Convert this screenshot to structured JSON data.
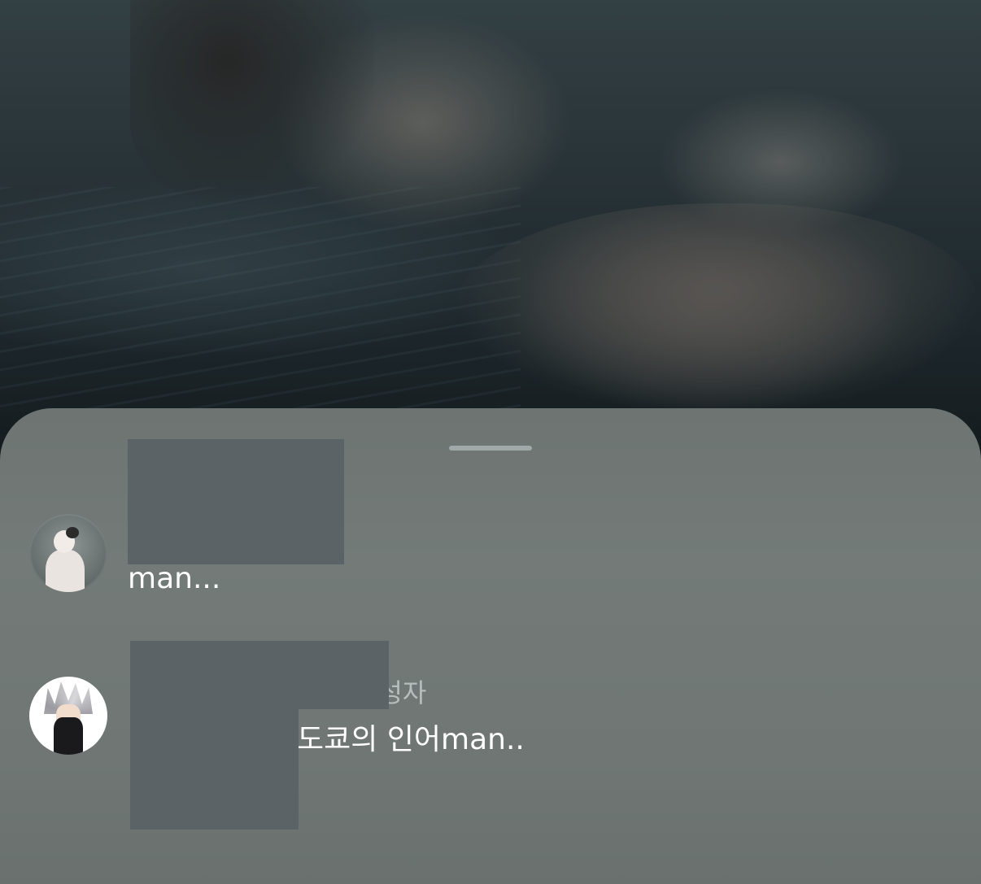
{
  "comments": [
    {
      "avatar_icon": "user-avatar-icon",
      "text": "man..."
    },
    {
      "avatar_icon": "user-avatar-icon",
      "badge": "작성자",
      "text": "도쿄의 인어man.."
    }
  ],
  "colors": {
    "sheet_background": "#707775",
    "redaction": "#5c6366",
    "text": "#ffffff",
    "secondary_text": "#cdd4d4"
  }
}
